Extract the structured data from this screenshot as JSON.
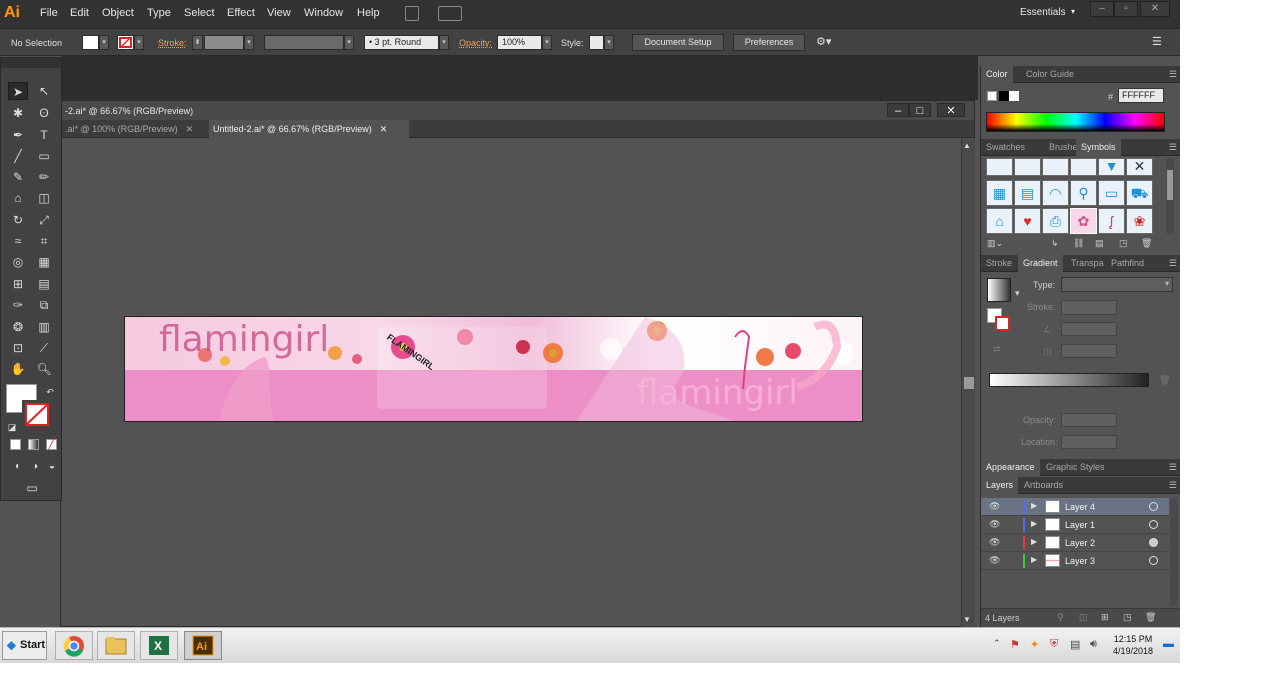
{
  "app": {
    "logo": "Ai",
    "menus": [
      "File",
      "Edit",
      "Object",
      "Type",
      "Select",
      "Effect",
      "View",
      "Window",
      "Help"
    ],
    "workspace": "Essentials"
  },
  "controlbar": {
    "selection": "No Selection",
    "stroke_label": "Stroke:",
    "brush": "3 pt. Round",
    "opacity_label": "Opacity:",
    "opacity_value": "100%",
    "style_label": "Style:",
    "document_setup": "Document Setup",
    "preferences": "Preferences"
  },
  "document": {
    "title": "-2.ai* @ 66.67% (RGB/Preview)",
    "tabs": [
      {
        "label": ".ai* @ 100% (RGB/Preview)",
        "active": false
      },
      {
        "label": "Untitled-2.ai* @ 66.67% (RGB/Preview)",
        "active": true
      }
    ],
    "artwork": {
      "logo_text": "flamingirl",
      "ghost_text": "flamingirl",
      "circle_text": "FLAMINGIRL"
    }
  },
  "panels": {
    "color": {
      "tabs": [
        "Color",
        "Color Guide"
      ],
      "hex_label": "#",
      "hex_value": "FFFFFF"
    },
    "symbols_tabs": [
      "Swatches",
      "Brushes",
      "Symbols"
    ],
    "gradient": {
      "tabs": [
        "Stroke",
        "Gradient",
        "Transpa",
        "Pathfind"
      ],
      "type_label": "Type:",
      "stroke_label": "Stroke:",
      "opacity_label": "Opacity:",
      "location_label": "Location:"
    },
    "appearance_tabs": [
      "Appearance",
      "Graphic Styles"
    ],
    "layers_tabs": [
      "Layers",
      "Artboards"
    ],
    "layers": [
      {
        "name": "Layer 4",
        "color": "#4b6cff",
        "selected": true
      },
      {
        "name": "Layer 1",
        "color": "#4b6cff",
        "selected": false
      },
      {
        "name": "Layer 2",
        "color": "#e23a3a",
        "selected": false
      },
      {
        "name": "Layer 3",
        "color": "#3acb3a",
        "selected": false
      }
    ],
    "layers_count": "4 Layers"
  },
  "taskbar": {
    "start": "Start",
    "time": "12:15 PM",
    "date": "4/19/2018"
  }
}
